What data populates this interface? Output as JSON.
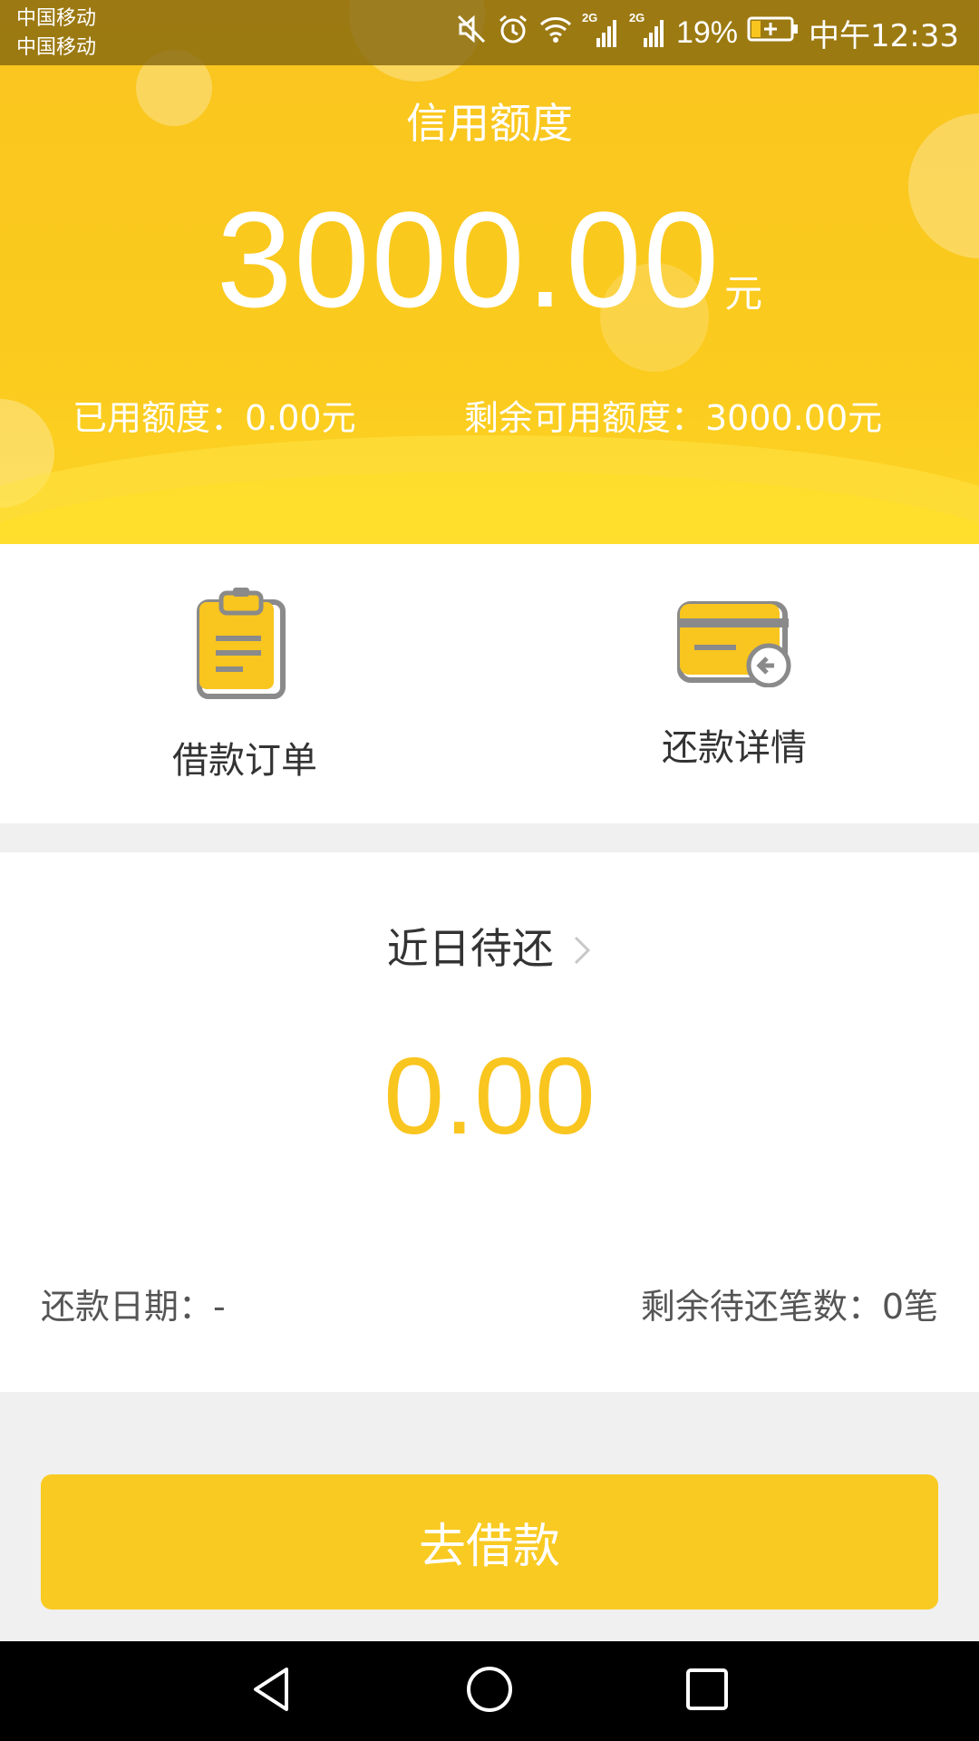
{
  "status_bar": {
    "carrier_1": "中国移动",
    "carrier_2": "中国移动",
    "battery_percent": "19%",
    "time": "中午12:33",
    "network_1": "2G",
    "network_2": "2G",
    "icons": [
      "mute-icon",
      "alarm-icon",
      "wifi-icon",
      "signal-icon",
      "signal-icon",
      "battery-charging-icon"
    ]
  },
  "credit": {
    "title": "信用额度",
    "amount": "3000.00",
    "unit": "元",
    "used_label": "已用额度：0.00元",
    "remaining_label": "剩余可用额度：3000.00元"
  },
  "actions": [
    {
      "label": "借款订单",
      "icon": "clipboard-icon"
    },
    {
      "label": "还款详情",
      "icon": "card-return-icon"
    }
  ],
  "recent": {
    "title": "近日待还",
    "amount": "0.00",
    "date_label": "还款日期：-",
    "count_label": "剩余待还笔数：0笔"
  },
  "borrow_button": {
    "label": "去借款"
  },
  "colors": {
    "accent": "#F9C51F",
    "text_dark": "#333333",
    "background": "#F0F0F0"
  }
}
